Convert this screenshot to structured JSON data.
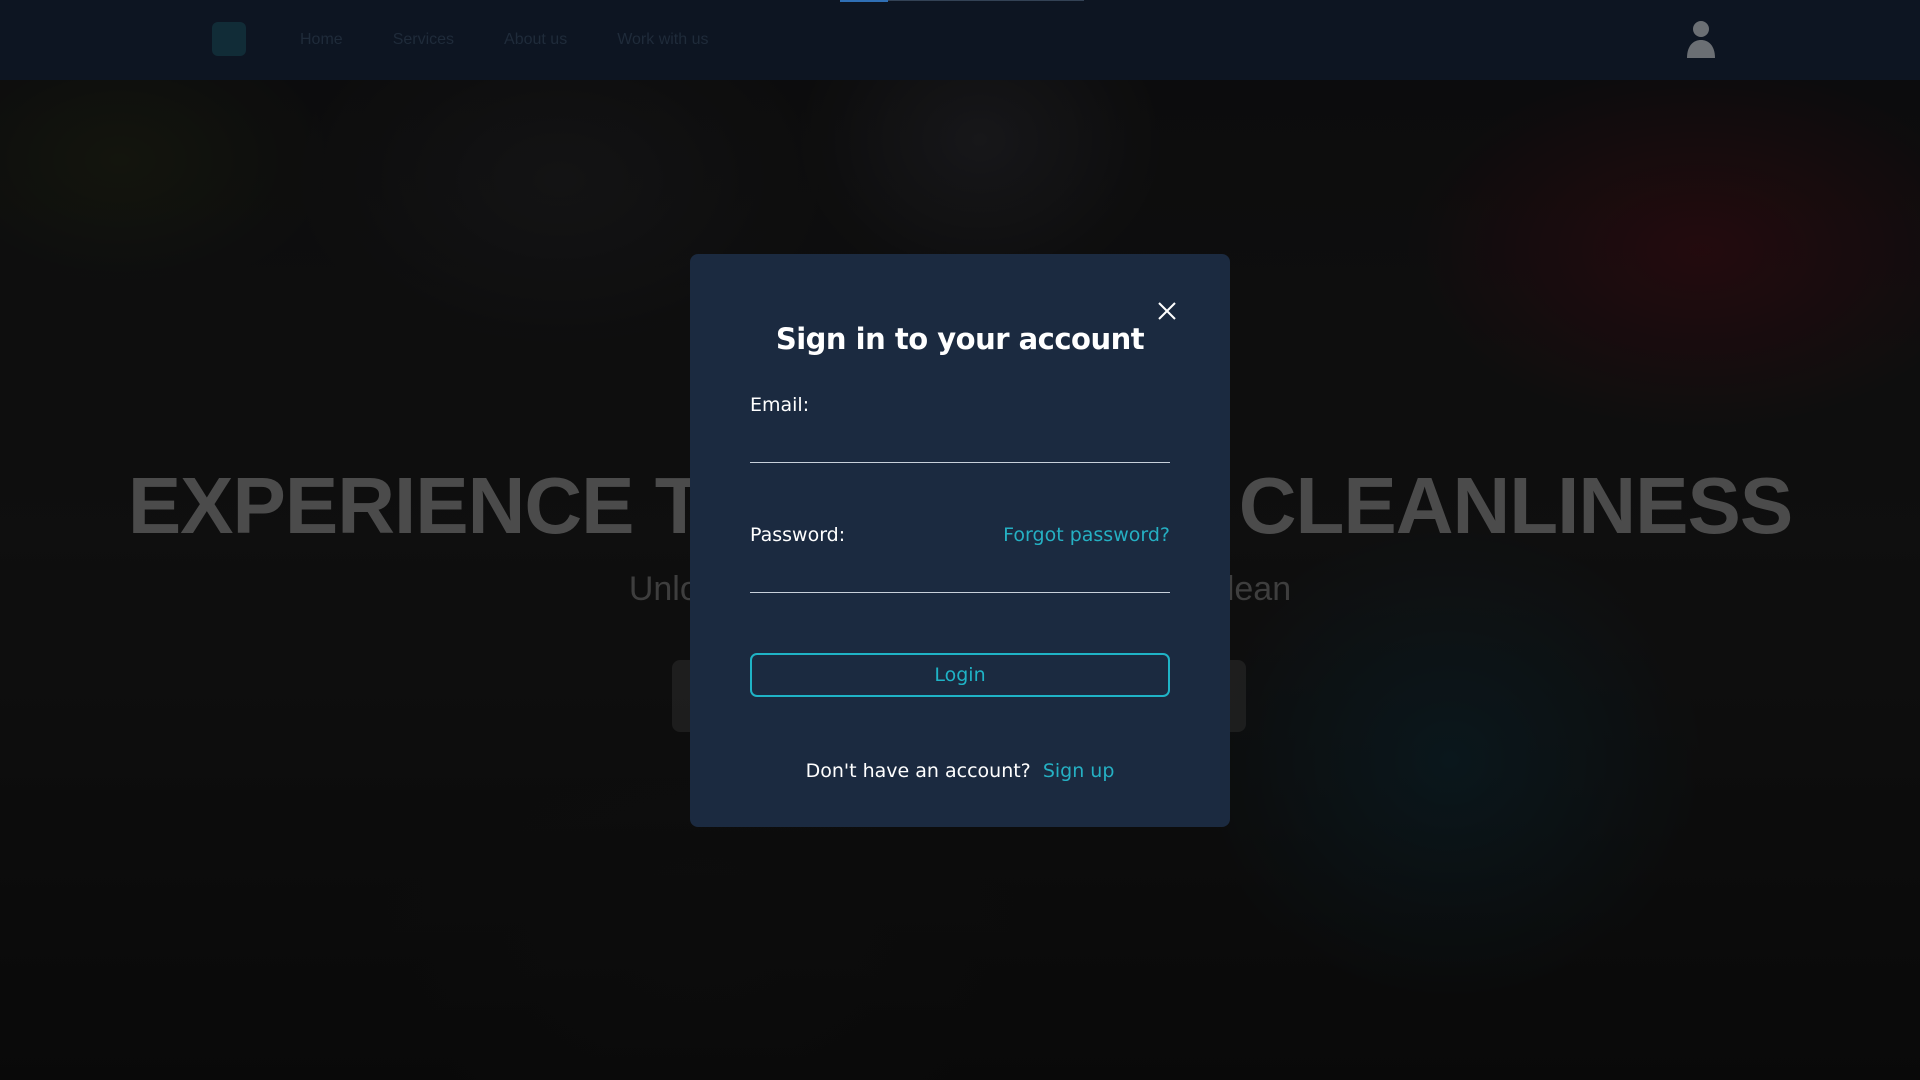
{
  "navbar": {
    "links": [
      "Home",
      "Services",
      "About us",
      "Work with us"
    ]
  },
  "hero": {
    "title": "EXPERIENCE THE ULTIMATE CLEANLINESS",
    "subtitle": "Unlock Your Home's Potential: Let Us Clean"
  },
  "modal": {
    "title": "Sign in to your account",
    "email_label": "Email:",
    "email_value": "",
    "password_label": "Password:",
    "password_value": "",
    "forgot_password": "Forgot password?",
    "login_button": "Login",
    "no_account_text": "Don't have an account?",
    "signup_link": "Sign up"
  },
  "icons": {
    "close": "close-icon",
    "user": "user-icon"
  },
  "colors": {
    "modal_bg": "#1b2a40",
    "accent": "#1fb3c6",
    "navbar_bg": "#0d1522"
  }
}
